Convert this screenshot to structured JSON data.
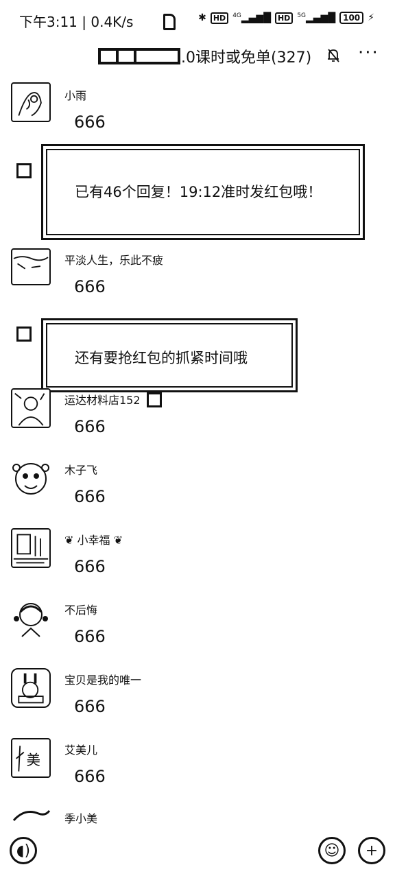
{
  "status_bar": {
    "time": "下午3:11 | 0.4K/s",
    "bluetooth": "✱",
    "hd1": "HD",
    "net1": "4G",
    "hd2": "HD",
    "net2": "5G",
    "battery": "100"
  },
  "header": {
    "title": ".0课时或免单(327)",
    "more": "···"
  },
  "messages": [
    {
      "nick": "小雨",
      "text": "666"
    },
    {
      "nick": "平淡人生，乐此不疲",
      "text": "666"
    },
    {
      "nick": "运达材料店152",
      "text": "666"
    },
    {
      "nick": "木子飞",
      "text": "666"
    },
    {
      "nick": "小幸福",
      "text": "666"
    },
    {
      "nick": "不后悔",
      "text": "666"
    },
    {
      "nick": "宝贝是我的唯一",
      "text": "666"
    },
    {
      "nick": "艾美儿",
      "text": "666"
    },
    {
      "nick": "季小美",
      "text": ""
    }
  ],
  "popups": [
    {
      "text": "已有46个回复！19:12准时发红包哦！"
    },
    {
      "text": "还有要抢红包的抓紧时间哦"
    }
  ],
  "bottom_bar": {
    "voice_icon": "voice-icon",
    "emoji_icon": "emoji-icon",
    "plus_icon": "plus-icon"
  }
}
